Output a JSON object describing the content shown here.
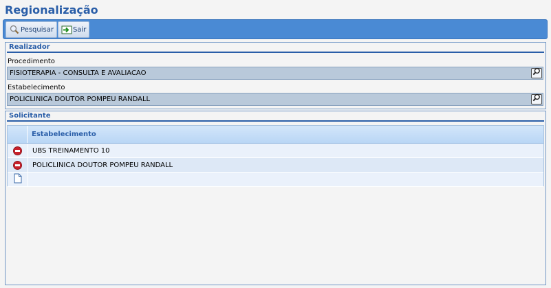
{
  "page": {
    "title": "Regionalização"
  },
  "toolbar": {
    "search_label": "Pesquisar",
    "exit_label": "Sair"
  },
  "realizador": {
    "legend": "Realizador",
    "procedimento_label": "Procedimento",
    "procedimento_value": "FISIOTERAPIA - CONSULTA E AVALIACAO",
    "estabelecimento_label": "Estabelecimento",
    "estabelecimento_value": "POLICLINICA DOUTOR POMPEU RANDALL"
  },
  "solicitante": {
    "legend": "Solicitante",
    "column_header": "Estabelecimento",
    "rows": [
      {
        "name": "UBS TREINAMENTO 10"
      },
      {
        "name": "POLICLINICA DOUTOR POMPEU RANDALL"
      }
    ]
  },
  "icons": {
    "search": "magnifier-icon",
    "exit": "exit-icon",
    "lookup": "lookup-magnifier-icon",
    "remove": "remove-icon",
    "new": "new-document-icon"
  },
  "colors": {
    "accent": "#2a5ea8",
    "toolbar": "#4a8ad4",
    "remove": "#c8212c"
  }
}
